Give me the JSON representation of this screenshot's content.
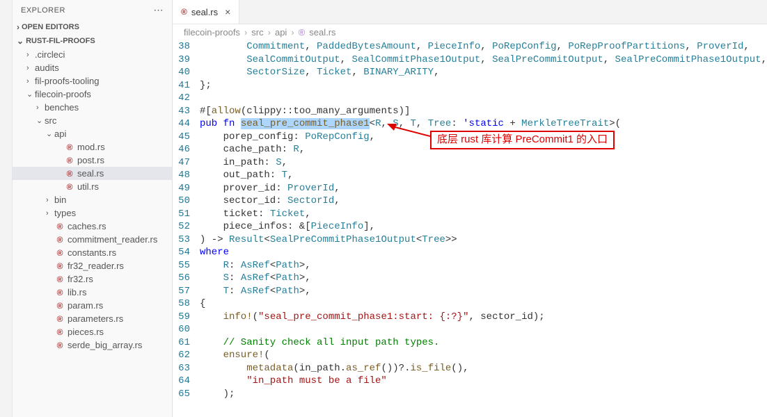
{
  "sidebar": {
    "title": "EXPLORER",
    "sections": {
      "open_editors": "OPEN EDITORS",
      "workspace": "RUST-FIL-PROOFS"
    },
    "tree": {
      "circleci": ".circleci",
      "audits": "audits",
      "fil_proofs_tooling": "fil-proofs-tooling",
      "filecoin_proofs": "filecoin-proofs",
      "benches": "benches",
      "src": "src",
      "api": "api",
      "mod_rs": "mod.rs",
      "post_rs": "post.rs",
      "seal_rs": "seal.rs",
      "util_rs": "util.rs",
      "bin": "bin",
      "types": "types",
      "caches_rs": "caches.rs",
      "commitment_reader_rs": "commitment_reader.rs",
      "constants_rs": "constants.rs",
      "fr32_reader_rs": "fr32_reader.rs",
      "fr32_rs": "fr32.rs",
      "lib_rs": "lib.rs",
      "param_rs": "param.rs",
      "parameters_rs": "parameters.rs",
      "pieces_rs": "pieces.rs",
      "serde_big_array_rs": "serde_big_array.rs"
    }
  },
  "tab": {
    "label": "seal.rs",
    "icon": "®"
  },
  "breadcrumb": {
    "p0": "filecoin-proofs",
    "p1": "src",
    "p2": "api",
    "p3": "seal.rs"
  },
  "annotation": "底层 rust 库计算 PreCommit1 的入口",
  "code": {
    "lines": [
      38,
      39,
      40,
      41,
      42,
      43,
      44,
      45,
      46,
      47,
      48,
      49,
      50,
      51,
      52,
      53,
      54,
      55,
      56,
      57,
      58,
      59,
      60,
      61,
      62,
      63,
      64,
      65
    ],
    "l38a": "        ",
    "l38b": "Commitment",
    "l38c": ", ",
    "l38d": "PaddedBytesAmount",
    "l38e": ", ",
    "l38f": "PieceInfo",
    "l38g": ", ",
    "l38h": "PoRepConfig",
    "l38i": ", ",
    "l38j": "PoRepProofPartitions",
    "l38k": ", ",
    "l38l": "ProverId",
    "l38m": ",",
    "l39a": "        ",
    "l39b": "SealCommitOutput",
    "l39c": ", ",
    "l39d": "SealCommitPhase1Output",
    "l39e": ", ",
    "l39f": "SealPreCommitOutput",
    "l39g": ", ",
    "l39h": "SealPreCommitPhase1Output",
    "l39i": ",",
    "l40a": "        ",
    "l40b": "SectorSize",
    "l40c": ", ",
    "l40d": "Ticket",
    "l40e": ", ",
    "l40f": "BINARY_ARITY",
    "l40g": ",",
    "l41": "};",
    "l42": "",
    "l43a": "#[",
    "l43b": "allow",
    "l43c": "(clippy::too_many_arguments)]",
    "l44a": "pub fn",
    "l44b": " ",
    "l44c": "seal_pre_commit_phase1",
    "l44d": "<",
    "l44e": "R",
    "l44f": ", ",
    "l44g": "S",
    "l44h": ", ",
    "l44i": "T",
    "l44j": ", ",
    "l44k": "Tree",
    "l44l": ": ",
    "l44m": "'static",
    "l44n": " + ",
    "l44o": "MerkleTreeTrait",
    "l44p": ">(",
    "l45a": "    porep_config: ",
    "l45b": "PoRepConfig",
    "l45c": ",",
    "l46a": "    cache_path: ",
    "l46b": "R",
    "l46c": ",",
    "l47a": "    in_path: ",
    "l47b": "S",
    "l47c": ",",
    "l48a": "    out_path: ",
    "l48b": "T",
    "l48c": ",",
    "l49a": "    prover_id: ",
    "l49b": "ProverId",
    "l49c": ",",
    "l50a": "    sector_id: ",
    "l50b": "SectorId",
    "l50c": ",",
    "l51a": "    ticket: ",
    "l51b": "Ticket",
    "l51c": ",",
    "l52a": "    piece_infos: &[",
    "l52b": "PieceInfo",
    "l52c": "],",
    "l53a": ") -> ",
    "l53b": "Result",
    "l53c": "<",
    "l53d": "SealPreCommitPhase1Output",
    "l53e": "<",
    "l53f": "Tree",
    "l53g": ">>",
    "l54": "where",
    "l55a": "    ",
    "l55b": "R",
    "l55c": ": ",
    "l55d": "AsRef",
    "l55e": "<",
    "l55f": "Path",
    "l55g": ">,",
    "l56a": "    ",
    "l56b": "S",
    "l56c": ": ",
    "l56d": "AsRef",
    "l56e": "<",
    "l56f": "Path",
    "l56g": ">,",
    "l57a": "    ",
    "l57b": "T",
    "l57c": ": ",
    "l57d": "AsRef",
    "l57e": "<",
    "l57f": "Path",
    "l57g": ">,",
    "l58": "{",
    "l59a": "    ",
    "l59b": "info!",
    "l59c": "(",
    "l59d": "\"seal_pre_commit_phase1:start: {:?}\"",
    "l59e": ", sector_id);",
    "l60": "",
    "l61a": "    ",
    "l61b": "// Sanity check all input path types.",
    "l62a": "    ",
    "l62b": "ensure!",
    "l62c": "(",
    "l63a": "        ",
    "l63b": "metadata",
    "l63c": "(in_path.",
    "l63d": "as_ref",
    "l63e": "())?.",
    "l63f": "is_file",
    "l63g": "(),",
    "l64a": "        ",
    "l64b": "\"in_path must be a file\"",
    "l65": "    );"
  }
}
